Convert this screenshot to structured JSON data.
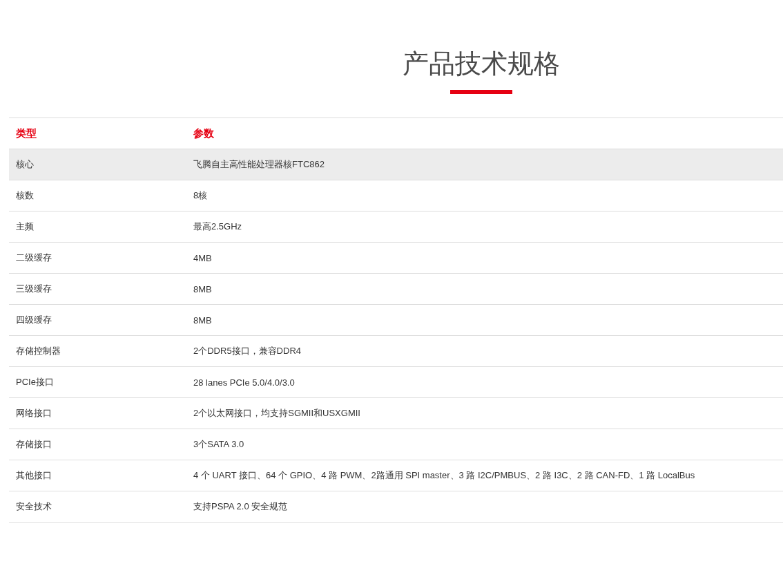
{
  "title": "产品技术规格",
  "table": {
    "columns": [
      "类型",
      "参数"
    ],
    "rows": [
      {
        "type": "核心",
        "value": "飞腾自主高性能处理器核FTC862",
        "highlighted": true
      },
      {
        "type": "核数",
        "value": "8核",
        "highlighted": false
      },
      {
        "type": "主频",
        "value": "最高2.5GHz",
        "highlighted": false
      },
      {
        "type": "二级缓存",
        "value": "4MB",
        "highlighted": false
      },
      {
        "type": "三级缓存",
        "value": "8MB",
        "highlighted": false
      },
      {
        "type": "四级缓存",
        "value": "8MB",
        "highlighted": false
      },
      {
        "type": "存储控制器",
        "value": "2个DDR5接口，兼容DDR4",
        "highlighted": false
      },
      {
        "type": "PCIe接口",
        "value": "28 lanes PCIe 5.0/4.0/3.0",
        "highlighted": false
      },
      {
        "type": "网络接口",
        "value": "2个以太网接口，均支持SGMII和USXGMII",
        "highlighted": false
      },
      {
        "type": "存储接口",
        "value": "3个SATA 3.0",
        "highlighted": false
      },
      {
        "type": "其他接口",
        "value": "4 个 UART 接口、64 个 GPIO、4 路 PWM、2路通用 SPI master、3 路 I2C/PMBUS、2 路 I3C、2 路 CAN-FD、1 路 LocalBus",
        "highlighted": false
      },
      {
        "type": "安全技术",
        "value": "支持PSPA 2.0 安全规范",
        "highlighted": false
      }
    ]
  }
}
